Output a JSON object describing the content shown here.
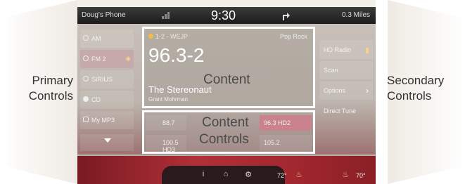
{
  "callouts": {
    "left_line1": "Primary",
    "left_line2": "Controls",
    "right_line1": "Secondary",
    "right_line2": "Controls",
    "content": "Content",
    "controls_line1": "Content",
    "controls_line2": "Controls"
  },
  "status": {
    "phone": "Doug's Phone",
    "time": "9:30",
    "distance": "0.3 Miles"
  },
  "sources": [
    {
      "label": "AM",
      "active": false
    },
    {
      "label": "FM 2",
      "active": true
    },
    {
      "label": "SIRIUS",
      "active": false
    },
    {
      "label": "CD",
      "active": false
    },
    {
      "label": "My MP3",
      "active": false
    }
  ],
  "now_playing": {
    "preset": "1-2 - WEJP",
    "genre": "Pop Rock",
    "frequency": "96.3-2",
    "song": "The Stereonaut",
    "artist": "Grant Mohrman"
  },
  "presets": [
    {
      "label": "88.7",
      "selected": false
    },
    {
      "label": "96.3 HD2",
      "selected": true
    },
    {
      "label": "100.5 HD3",
      "selected": false
    },
    {
      "label": "105.2",
      "selected": false
    }
  ],
  "secondary": [
    {
      "label": "HD Radio"
    },
    {
      "label": "Scan"
    },
    {
      "label": "Options"
    },
    {
      "label": "Direct Tune"
    }
  ],
  "climate": {
    "driver_temp": "72°",
    "passenger_temp": "70°"
  },
  "colors": {
    "accent_fm": "#c6a9a9",
    "preset_selected": "#c9828e",
    "climate_bar": "#b03038"
  }
}
